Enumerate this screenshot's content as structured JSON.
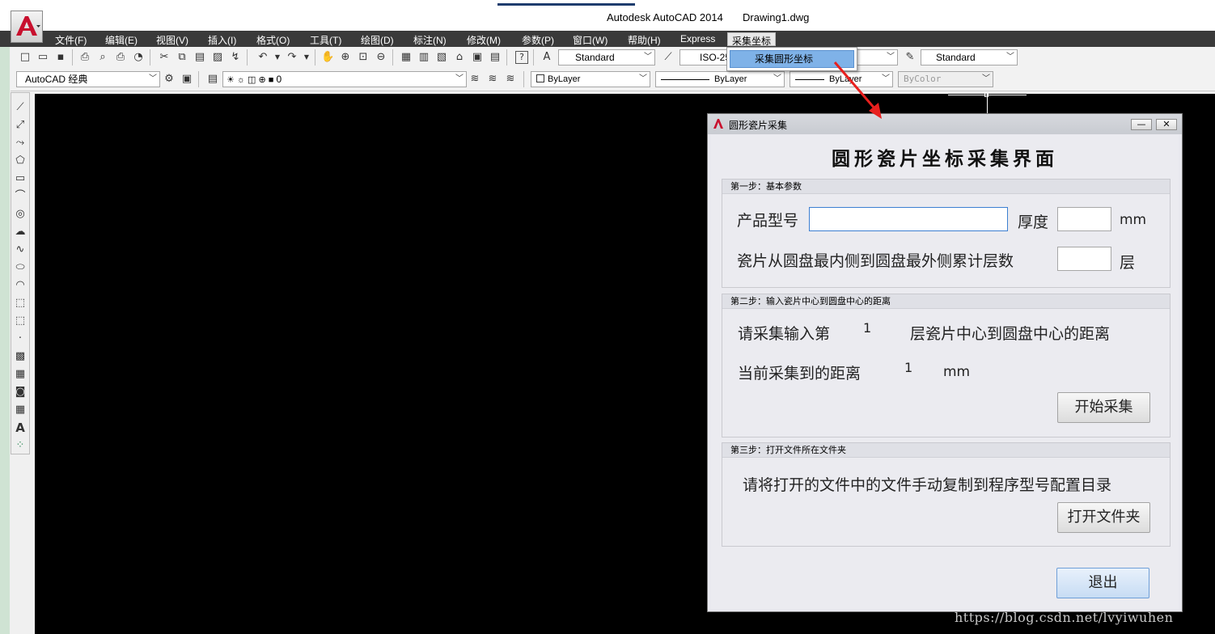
{
  "window": {
    "title": "Autodesk AutoCAD 2014",
    "file": "Drawing1.dwg"
  },
  "menu": {
    "items": [
      "文件(F)",
      "编辑(E)",
      "视图(V)",
      "插入(I)",
      "格式(O)",
      "工具(T)",
      "绘图(D)",
      "标注(N)",
      "修改(M)",
      "参数(P)",
      "窗口(W)",
      "帮助(H)",
      "Express"
    ],
    "active": "采集坐标",
    "dropdown_item": "采集圆形坐标"
  },
  "toolbar": {
    "text_style": "Standard",
    "dim_style": "ISO-25",
    "table_style": "Standard",
    "workspace": "AutoCAD 经典",
    "layer": "0",
    "color": "ByLayer",
    "linetype": "ByLayer",
    "lineweight": "ByLayer",
    "plotstyle": "ByColor"
  },
  "dialog": {
    "title": "圆形瓷片采集",
    "heading": "圆形瓷片坐标采集界面",
    "minimize": "—",
    "close": "✕",
    "step1": {
      "title": "第一步：基本参数",
      "product_label": "产品型号",
      "product_value": "",
      "thickness_label": "厚度",
      "thickness_value": "",
      "thickness_unit": "mm",
      "layers_label": "瓷片从圆盘最内侧到圆盘最外侧累计层数",
      "layers_value": "",
      "layers_unit": "层"
    },
    "step2": {
      "title": "第二步：输入瓷片中心到圆盘中心的距离",
      "prompt_prefix": "请采集输入第",
      "layer_index": "1",
      "prompt_suffix": "层瓷片中心到圆盘中心的距离",
      "current_label": "当前采集到的距离",
      "current_value": "1",
      "current_unit": "mm",
      "start_button": "开始采集"
    },
    "step3": {
      "title": "第三步：打开文件所在文件夹",
      "instruction": "请将打开的文件中的文件手动复制到程序型号配置目录",
      "open_button": "打开文件夹"
    },
    "exit_button": "退出"
  },
  "watermark": "https://blog.csdn.net/lvyiwuhen",
  "colors": {
    "accent": "#7fb2e8",
    "canvas": "#000000",
    "menubar": "#3a3a3a",
    "logo_red": "#c8102e"
  }
}
